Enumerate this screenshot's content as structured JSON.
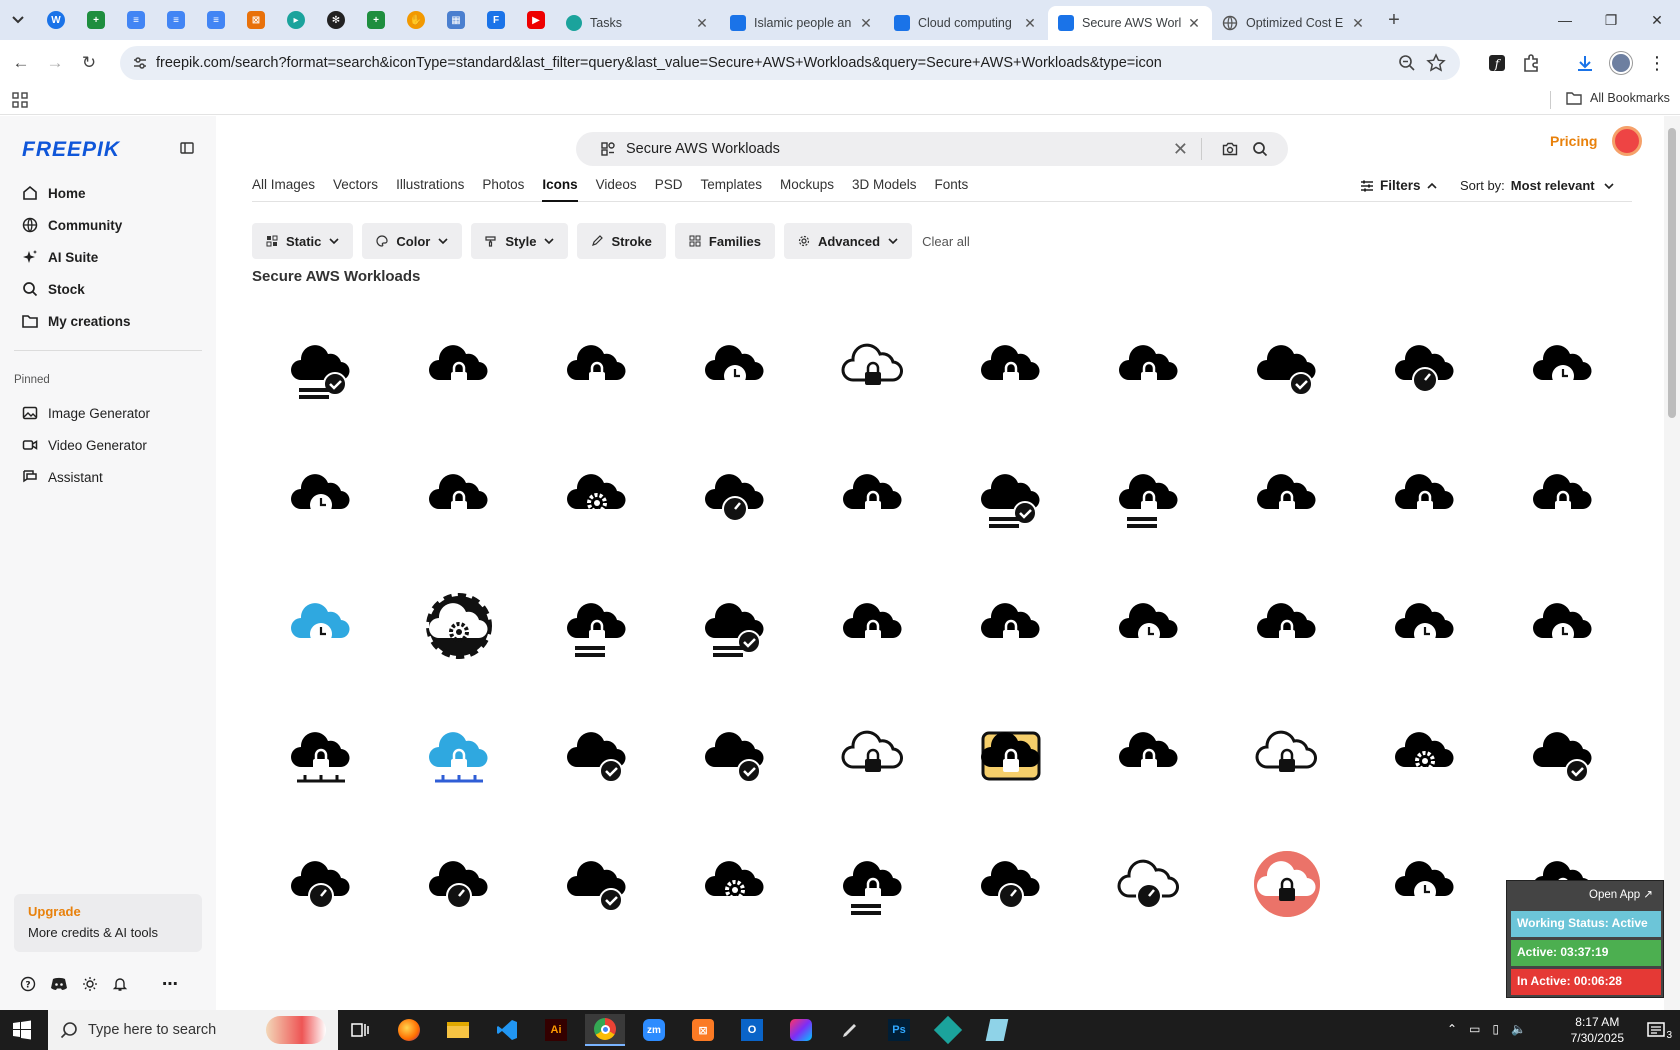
{
  "browser": {
    "tabs": [
      {
        "title": "Tasks",
        "active": false
      },
      {
        "title": "Islamic people an",
        "active": false
      },
      {
        "title": "Cloud computing",
        "active": false
      },
      {
        "title": "Secure AWS Worl",
        "active": true
      },
      {
        "title": "Optimized Cost E",
        "active": false
      }
    ],
    "url": "freepik.com/search?format=search&iconType=standard&last_filter=query&last_value=Secure+AWS+Workloads&query=Secure+AWS+Workloads&type=icon",
    "bookmarks_label": "All Bookmarks"
  },
  "sidebar": {
    "logo": "FREEPIK",
    "items": [
      {
        "label": "Home",
        "icon": "home-icon"
      },
      {
        "label": "Community",
        "icon": "globe-icon"
      },
      {
        "label": "AI Suite",
        "icon": "sparkle-icon"
      },
      {
        "label": "Stock",
        "icon": "search-icon"
      },
      {
        "label": "My creations",
        "icon": "folder-icon"
      }
    ],
    "pinned_label": "Pinned",
    "pinned": [
      {
        "label": "Image Generator",
        "icon": "image-icon"
      },
      {
        "label": "Video Generator",
        "icon": "video-icon"
      },
      {
        "label": "Assistant",
        "icon": "chat-icon"
      }
    ],
    "upgrade": {
      "title": "Upgrade",
      "subtitle": "More credits & AI tools"
    }
  },
  "header": {
    "search_value": "Secure AWS Workloads",
    "pricing": "Pricing"
  },
  "content_tabs": [
    "All Images",
    "Vectors",
    "Illustrations",
    "Photos",
    "Icons",
    "Videos",
    "PSD",
    "Templates",
    "Mockups",
    "3D Models",
    "Fonts"
  ],
  "active_tab": "Icons",
  "filters_label": "Filters",
  "sort": {
    "label": "Sort by:",
    "value": "Most relevant"
  },
  "chips": [
    "Static",
    "Color",
    "Style",
    "Stroke",
    "Families",
    "Advanced"
  ],
  "clear_all": "Clear all",
  "results_title": "Secure AWS Workloads",
  "icons": [
    "cloud-lock-checklist-icon",
    "lock-cloud-circuit-icon",
    "gear-lock-icon",
    "cloud-clock-icon",
    "cloud-lock-outline-icon",
    "laptop-cloud-wifi-icon",
    "cloud-lock-small-icon",
    "cloud-lock-check-icon",
    "laptop-cloud-gauge-icon",
    "cloud-gear-clock-icon",
    "cloud-clock-gear-icon",
    "lock-cloud-gear-icon",
    "cloud-gear-icon",
    "cloud-laptop-gauge-icon",
    "cloud-lock-toolbox-icon",
    "cloud-server-check-icon",
    "cloud-lock-list-icon",
    "cloud-lock-gear-icon",
    "cloud-lock-shield-icon",
    "cloud-laptop-circle-icon",
    "cloud-timer-blue-icon",
    "gear-cloud-icon",
    "cloud-lock-server-icon",
    "cloud-server-check-icon",
    "cloud-gear-lock-icon",
    "monitor-wifi-lock-icon",
    "cloud-stopwatch-icon",
    "user-gear-lock-icon",
    "stopwatch-arrows-icon",
    "cloud-gear-timer-icon",
    "cloud-network-lock-icon",
    "cloud-network-blue-icon",
    "cloud-folder-check-icon",
    "cloud-folder-check-icon",
    "cloud-lock-outline-icon",
    "laptop-cloud-wifi-yellow-icon",
    "cloud-gear-lock-small-icon",
    "cloud-lock-outline-icon",
    "cloud-gear-folder-icon",
    "cloud-lock-check-small-icon",
    "cloud-gauge-icon",
    "cloud-gauge-small-icon",
    "cloud-lock-check-icon",
    "cloud-shield-gear-icon",
    "server-lock-icon",
    "cloud-gauge-icon",
    "cloud-gauge-outline-icon",
    "cloud-lock-gradient-icon",
    "stopwatch-power-icon",
    "cloud-lock-icon"
  ],
  "widget": {
    "open_app": "Open App ↗",
    "status": "Working Status: Active",
    "active": "Active: 03:37:19",
    "inactive": "In Active: 00:06:28"
  },
  "taskbar": {
    "search_placeholder": "Type here to search",
    "time": "8:17 AM",
    "date": "7/30/2025"
  },
  "colors": {
    "brand": "#0f56d9",
    "accent": "#e8810c"
  }
}
